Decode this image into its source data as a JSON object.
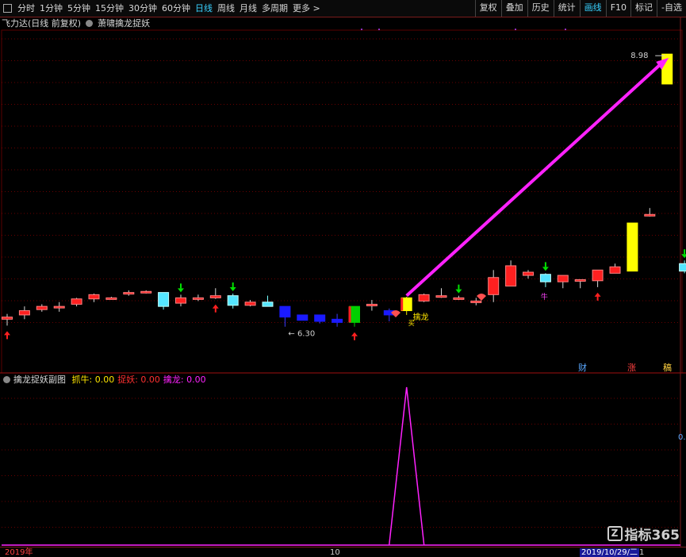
{
  "toolbar": {
    "periods": [
      "分时",
      "1分钟",
      "5分钟",
      "15分钟",
      "30分钟",
      "60分钟",
      "日线",
      "周线",
      "月线",
      "多周期",
      "更多 >"
    ],
    "active_period": "日线",
    "right_buttons": [
      "复权",
      "叠加",
      "历史",
      "统计",
      "画线",
      "F10",
      "标记",
      "-自选"
    ],
    "active_right": "画线"
  },
  "main_legend": {
    "title": "飞力达(日线 前复权)",
    "indicator": "萧啸擒龙捉妖"
  },
  "sub_legend": {
    "title": "擒龙捉妖副图",
    "items": [
      {
        "label": "抓牛:",
        "value": "0.00",
        "color": "#ffe600"
      },
      {
        "label": "捉妖:",
        "value": "0.00",
        "color": "#ff3030"
      },
      {
        "label": "擒龙:",
        "value": "0.00",
        "color": "#ff22ff"
      }
    ]
  },
  "annotations": {
    "high_price": "8.98",
    "low_price": "6.30",
    "signal_text": "擒龙",
    "signal_text2": "买",
    "bull_mark": "牛"
  },
  "markers": [
    {
      "text": "财",
      "color": "#5aa8ff"
    },
    {
      "text": "涨",
      "color": "#ff4040"
    },
    {
      "text": "稿",
      "color": "#ffd040"
    }
  ],
  "right_axis_value": "0.",
  "bottom_axis": {
    "left": "2019年",
    "mid": "10",
    "date": "2019/10/29/二",
    "tail": "1"
  },
  "watermark": "指标365",
  "colors": {
    "up": "#ff2020",
    "down": "#55e6ff",
    "blue": "#1a1aff",
    "yellow": "#ffff00",
    "green": "#00d000",
    "magenta": "#ff22ff",
    "grid": "#8b0000"
  },
  "chart_data": {
    "type": "candlestick",
    "candles": [
      {
        "o": 6.5,
        "c": 6.52,
        "h": 6.55,
        "l": 6.44,
        "col": "up",
        "sig": "red-up"
      },
      {
        "o": 6.54,
        "c": 6.58,
        "h": 6.62,
        "l": 6.5,
        "col": "up"
      },
      {
        "o": 6.59,
        "c": 6.62,
        "h": 6.64,
        "l": 6.57,
        "col": "up"
      },
      {
        "o": 6.61,
        "c": 6.62,
        "h": 6.66,
        "l": 6.57,
        "col": "up"
      },
      {
        "o": 6.64,
        "c": 6.69,
        "h": 6.7,
        "l": 6.62,
        "col": "up"
      },
      {
        "o": 6.69,
        "c": 6.73,
        "h": 6.74,
        "l": 6.66,
        "col": "up"
      },
      {
        "o": 6.69,
        "c": 6.7,
        "h": 6.71,
        "l": 6.69,
        "col": "up"
      },
      {
        "o": 6.74,
        "c": 6.75,
        "h": 6.77,
        "l": 6.72,
        "col": "up"
      },
      {
        "o": 6.75,
        "c": 6.76,
        "h": 6.77,
        "l": 6.74,
        "col": "up"
      },
      {
        "o": 6.75,
        "c": 6.62,
        "h": 6.75,
        "l": 6.59,
        "col": "down"
      },
      {
        "o": 6.65,
        "c": 6.7,
        "h": 6.73,
        "l": 6.62,
        "col": "up",
        "sig": "green-down"
      },
      {
        "o": 6.7,
        "c": 6.7,
        "h": 6.73,
        "l": 6.67,
        "col": "up"
      },
      {
        "o": 6.7,
        "c": 6.72,
        "h": 6.79,
        "l": 6.69,
        "col": "up",
        "sig": "red-up"
      },
      {
        "o": 6.72,
        "c": 6.63,
        "h": 6.74,
        "l": 6.6,
        "col": "down",
        "sig": "green-down"
      },
      {
        "o": 6.63,
        "c": 6.66,
        "h": 6.68,
        "l": 6.62,
        "col": "up"
      },
      {
        "o": 6.66,
        "c": 6.62,
        "h": 6.72,
        "l": 6.62,
        "col": "down"
      },
      {
        "o": 6.62,
        "c": 6.52,
        "h": 6.62,
        "l": 6.43,
        "col": "blue"
      },
      {
        "o": 6.54,
        "c": 6.49,
        "h": 6.54,
        "l": 6.49,
        "col": "blue"
      },
      {
        "o": 6.54,
        "c": 6.48,
        "h": 6.54,
        "l": 6.46,
        "col": "blue"
      },
      {
        "o": 6.5,
        "c": 6.47,
        "h": 6.55,
        "l": 6.43,
        "col": "blue"
      },
      {
        "o": 6.47,
        "c": 6.62,
        "h": 6.62,
        "l": 6.43,
        "col": "green",
        "sig": "red-up"
      },
      {
        "o": 6.64,
        "c": 6.64,
        "h": 6.68,
        "l": 6.58,
        "col": "up"
      },
      {
        "o": 6.58,
        "c": 6.54,
        "h": 6.6,
        "l": 6.48,
        "col": "blue"
      },
      {
        "o": 6.58,
        "c": 6.7,
        "h": 6.71,
        "l": 6.54,
        "col": "yellow",
        "sig": "buy"
      },
      {
        "o": 6.67,
        "c": 6.73,
        "h": 6.74,
        "l": 6.66,
        "col": "up"
      },
      {
        "o": 6.71,
        "c": 6.72,
        "h": 6.79,
        "l": 6.7,
        "col": "up"
      },
      {
        "o": 6.69,
        "c": 6.7,
        "h": 6.72,
        "l": 6.68,
        "col": "up",
        "sig": "green-down"
      },
      {
        "o": 6.67,
        "c": 6.67,
        "h": 6.7,
        "l": 6.63,
        "col": "up"
      },
      {
        "o": 6.73,
        "c": 6.89,
        "h": 6.96,
        "l": 6.66,
        "col": "up"
      },
      {
        "o": 6.81,
        "c": 7.0,
        "h": 7.05,
        "l": 6.81,
        "col": "up"
      },
      {
        "o": 6.94,
        "c": 6.91,
        "h": 6.96,
        "l": 6.88,
        "col": "up"
      },
      {
        "o": 6.92,
        "c": 6.85,
        "h": 6.93,
        "l": 6.8,
        "col": "down",
        "sig": "green-down"
      },
      {
        "o": 6.85,
        "c": 6.91,
        "h": 6.91,
        "l": 6.79,
        "col": "up"
      },
      {
        "o": 6.87,
        "c": 6.86,
        "h": 6.87,
        "l": 6.79,
        "col": "up"
      },
      {
        "o": 6.86,
        "c": 6.96,
        "h": 6.96,
        "l": 6.8,
        "col": "up",
        "sig": "red-up"
      },
      {
        "o": 6.93,
        "c": 6.99,
        "h": 7.02,
        "l": 6.93,
        "col": "up"
      },
      {
        "o": 6.95,
        "c": 7.4,
        "h": 7.4,
        "l": 6.95,
        "col": "yellow"
      },
      {
        "o": 7.48,
        "c": 7.48,
        "h": 7.54,
        "l": 7.46,
        "col": "up"
      },
      {
        "o": 8.7,
        "c": 8.98,
        "h": 8.98,
        "l": 8.7,
        "col": "yellow"
      },
      {
        "o": 7.02,
        "c": 6.95,
        "h": 7.05,
        "l": 6.93,
        "col": "down",
        "sig": "green-down"
      }
    ],
    "sub_indicator": {
      "name": "擒龙",
      "peak_index": 23,
      "peak_value": 1.0
    }
  }
}
